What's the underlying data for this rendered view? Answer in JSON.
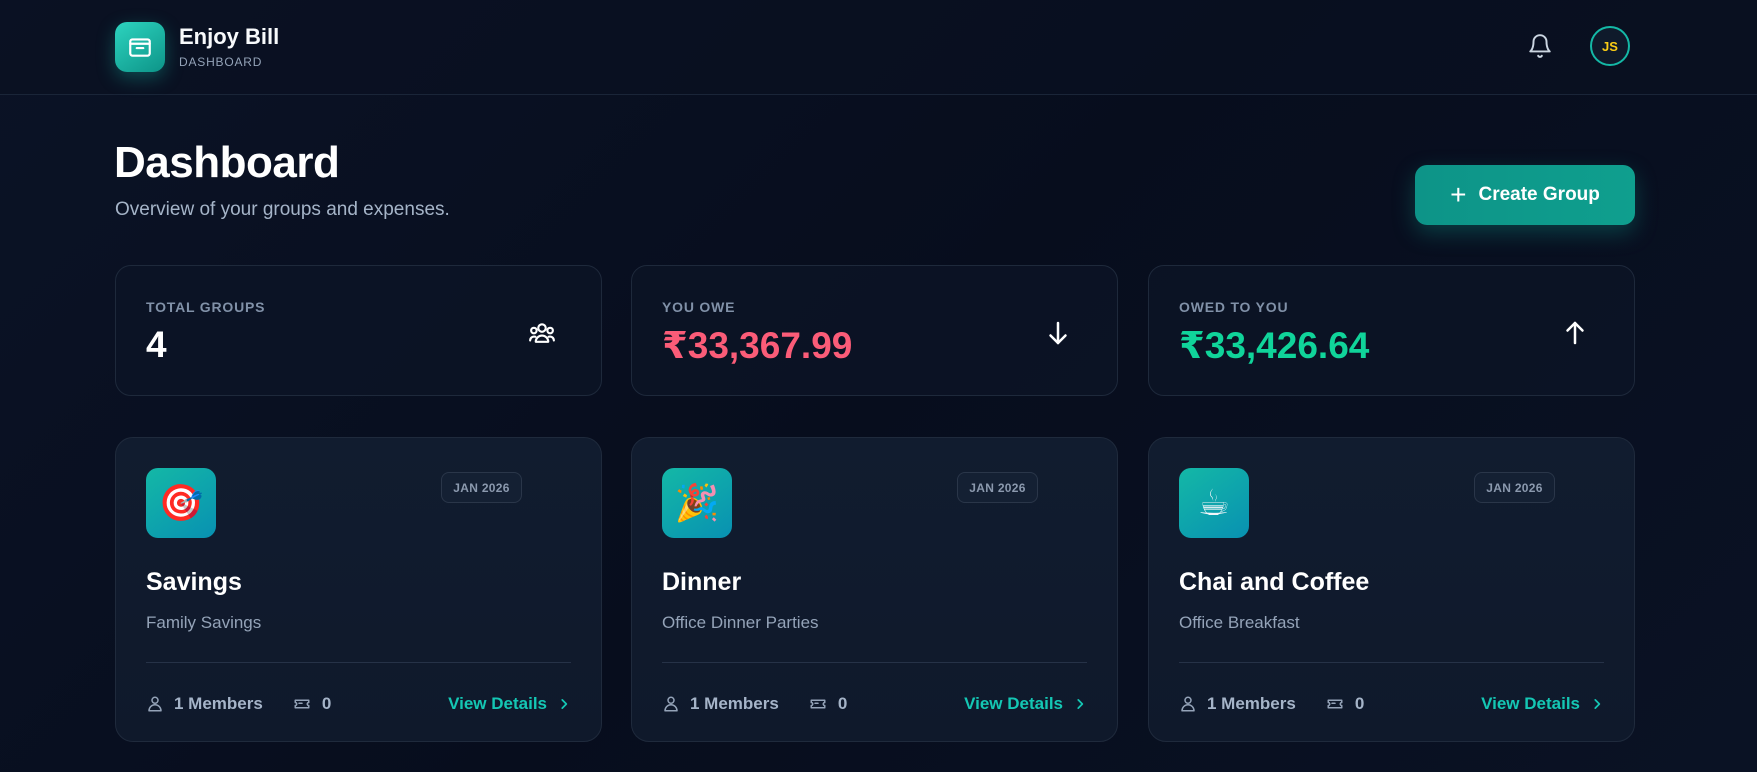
{
  "header": {
    "app_name": "Enjoy Bill",
    "section": "DASHBOARD",
    "logo_icon": "wallet-icon",
    "notification_icon": "bell-icon",
    "avatar_initials": "JS"
  },
  "page": {
    "title": "Dashboard",
    "subtitle": "Overview of your groups and expenses.",
    "create_button_label": "Create Group"
  },
  "stats": [
    {
      "label": "TOTAL GROUPS",
      "value": "4",
      "icon": "users-icon",
      "color": "#ffffff"
    },
    {
      "label": "YOU OWE",
      "value": "₹33,367.99",
      "icon": "arrow-down-icon",
      "color": "#fb5c78"
    },
    {
      "label": "OWED TO YOU",
      "value": "₹33,426.64",
      "icon": "arrow-up-icon",
      "color": "#10d49a"
    }
  ],
  "groups": [
    {
      "emoji": "🎯",
      "date": "JAN 2026",
      "name": "Savings",
      "description": "Family Savings",
      "members": "1 Members",
      "expenses": "0",
      "link": "View Details"
    },
    {
      "emoji": "🎉",
      "date": "JAN 2026",
      "name": "Dinner",
      "description": "Office Dinner Parties",
      "members": "1 Members",
      "expenses": "0",
      "link": "View Details"
    },
    {
      "emoji": "☕",
      "date": "JAN 2026",
      "name": "Chai and Coffee",
      "description": "Office Breakfast",
      "members": "1 Members",
      "expenses": "0",
      "link": "View Details"
    }
  ],
  "colors": {
    "accent": "#14b8a6",
    "negative": "#fb5c78",
    "positive": "#10d49a"
  }
}
